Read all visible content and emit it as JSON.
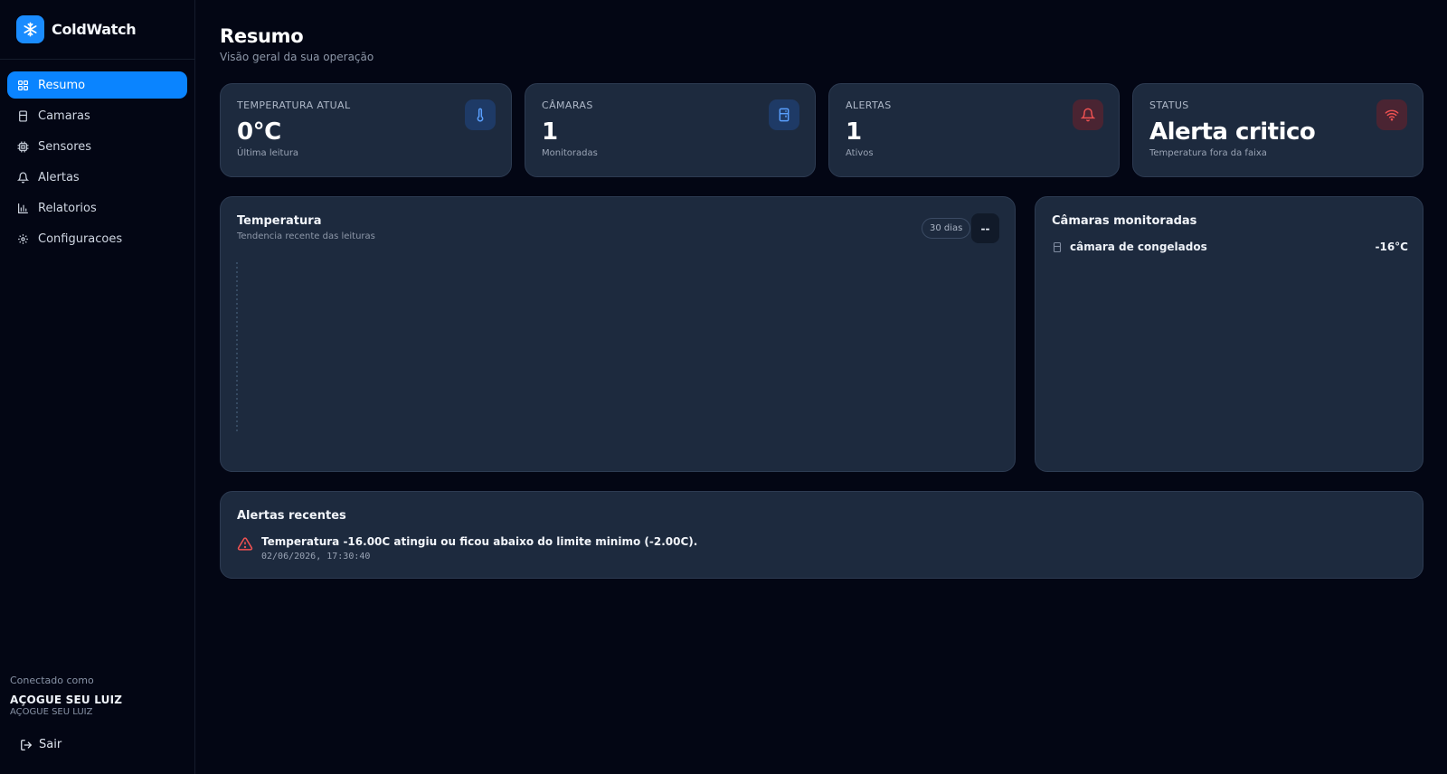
{
  "app": {
    "name": "ColdWatch"
  },
  "sidebar": {
    "items": [
      {
        "label": "Resumo",
        "icon": "grid-icon",
        "active": true
      },
      {
        "label": "Camaras",
        "icon": "fridge-icon",
        "active": false
      },
      {
        "label": "Sensores",
        "icon": "chip-icon",
        "active": false
      },
      {
        "label": "Alertas",
        "icon": "bell-icon",
        "active": false
      },
      {
        "label": "Relatorios",
        "icon": "bar-chart-icon",
        "active": false
      },
      {
        "label": "Configuracoes",
        "icon": "gear-icon",
        "active": false
      }
    ],
    "user": {
      "caption": "Conectado como",
      "name": "AÇOGUE SEU LUIZ",
      "subtitle": "AÇOGUE SEU LUIZ"
    },
    "logout_label": "Sair"
  },
  "header": {
    "title": "Resumo",
    "subtitle": "Visão geral da sua operação"
  },
  "stats": [
    {
      "label": "TEMPERATURA ATUAL",
      "value": "0°C",
      "desc": "Última leitura",
      "icon": "thermometer-icon",
      "accent": "#3b82f6"
    },
    {
      "label": "CÂMARAS",
      "value": "1",
      "desc": "Monitoradas",
      "icon": "fridge-icon",
      "accent": "#3b82f6"
    },
    {
      "label": "ALERTAS",
      "value": "1",
      "desc": "Ativos",
      "icon": "bell-icon",
      "accent": "#ef4444"
    },
    {
      "label": "STATUS",
      "value": "Alerta critico",
      "desc": "Temperatura fora da faixa",
      "icon": "wifi-icon",
      "accent": "#ef4444"
    }
  ],
  "temperature_panel": {
    "title": "Temperatura",
    "subtitle": "Tendencia recente das leituras",
    "range_label": "30 dias",
    "menu_label": "--"
  },
  "chambers_panel": {
    "title": "Câmaras monitoradas",
    "items": [
      {
        "name": "câmara de congelados",
        "temp": "-16°C"
      }
    ]
  },
  "alerts_panel": {
    "title": "Alertas recentes",
    "items": [
      {
        "message": "Temperatura -16.00C atingiu ou ficou abaixo do limite minimo (-2.00C).",
        "time": "02/06/2026, 17:30:40"
      }
    ]
  },
  "colors": {
    "accent": "#0a84ff",
    "card_bg": "#1d2a3e",
    "page_bg": "#030614",
    "danger": "#ef4444"
  }
}
